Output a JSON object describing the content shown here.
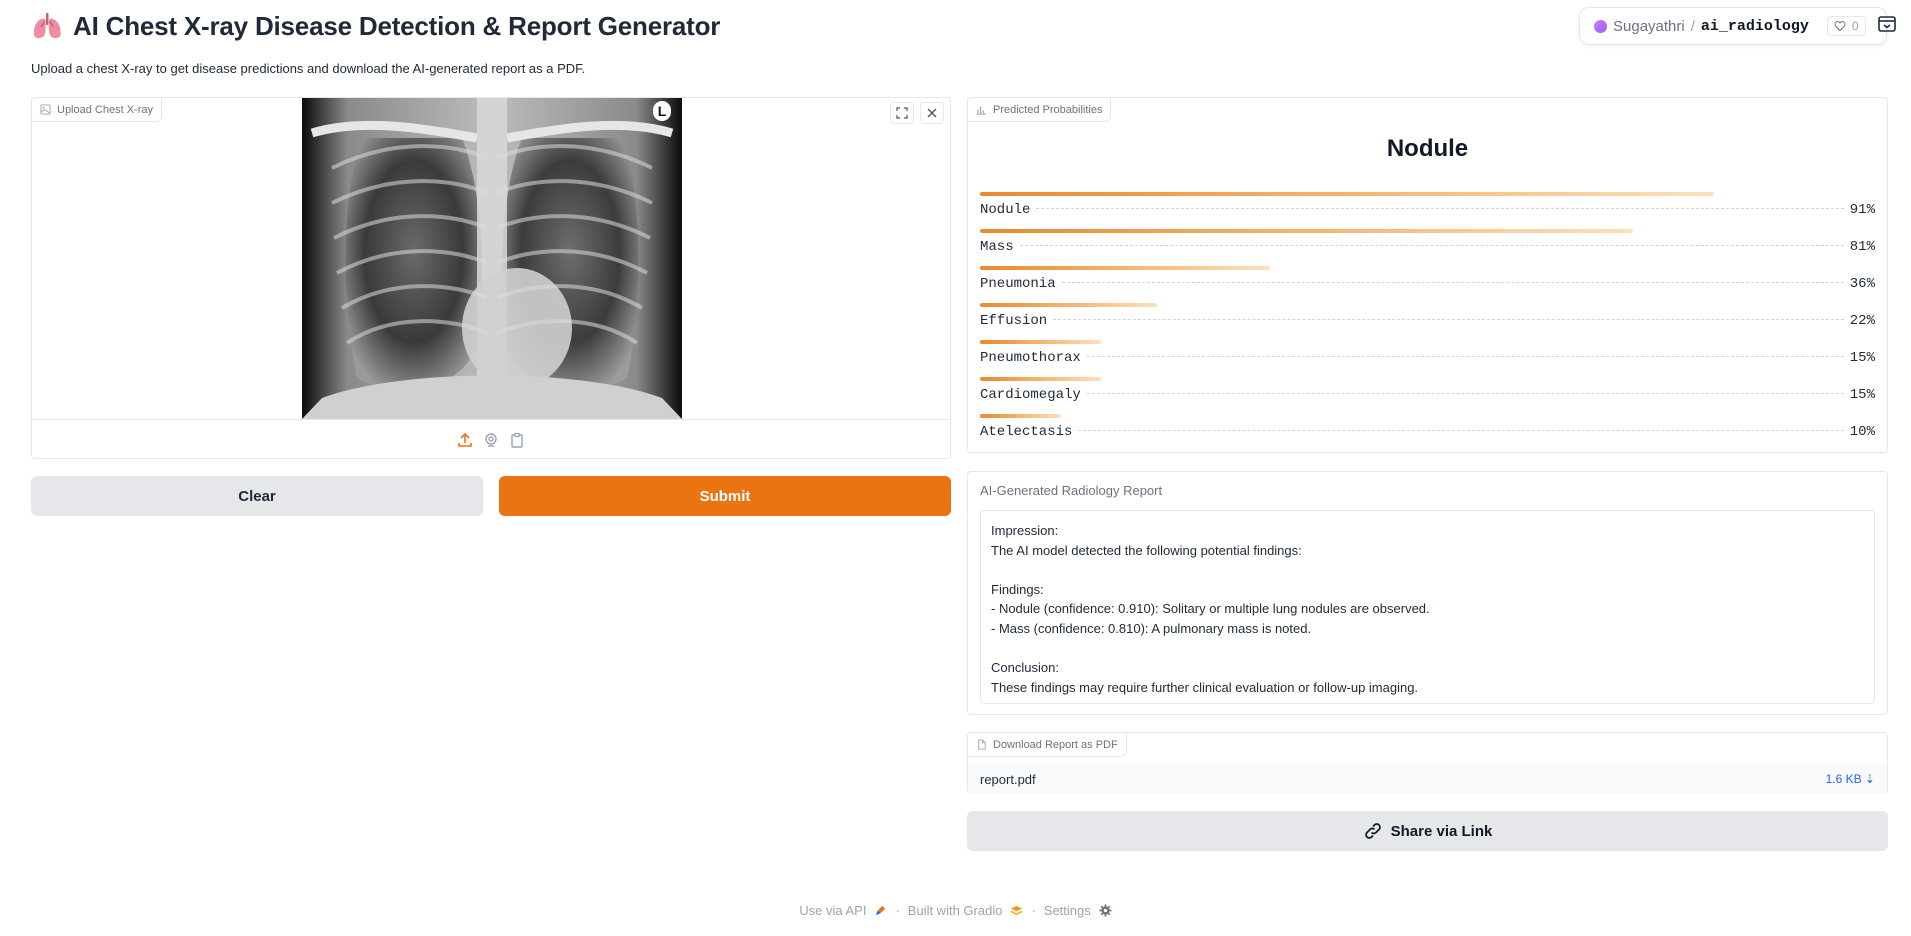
{
  "header": {
    "title": "AI Chest X-ray Disease Detection & Report Generator",
    "subtitle": "Upload a chest X-ray to get disease predictions and download the AI-generated report as a PDF."
  },
  "space": {
    "owner": "Sugayathri",
    "separator": "/",
    "name": "ai_radiology",
    "likes": "0"
  },
  "upload": {
    "label": "Upload Chest X-ray",
    "marker": "L"
  },
  "buttons": {
    "clear": "Clear",
    "submit": "Submit",
    "share": "Share via Link"
  },
  "predictions": {
    "label": "Predicted Probabilities",
    "top": "Nodule",
    "items": [
      {
        "label": "Nodule",
        "pct": "91%",
        "value": 0.91
      },
      {
        "label": "Mass",
        "pct": "81%",
        "value": 0.81
      },
      {
        "label": "Pneumonia",
        "pct": "36%",
        "value": 0.36
      },
      {
        "label": "Effusion",
        "pct": "22%",
        "value": 0.22
      },
      {
        "label": "Pneumothorax",
        "pct": "15%",
        "value": 0.15
      },
      {
        "label": "Cardiomegaly",
        "pct": "15%",
        "value": 0.15
      },
      {
        "label": "Atelectasis",
        "pct": "10%",
        "value": 0.1
      }
    ]
  },
  "report": {
    "label": "AI-Generated Radiology Report",
    "text": "Impression:\nThe AI model detected the following potential findings:\n\nFindings:\n- Nodule (confidence: 0.910): Solitary or multiple lung nodules are observed.\n- Mass (confidence: 0.810): A pulmonary mass is noted.\n\nConclusion:\nThese findings may require further clinical evaluation or follow-up imaging."
  },
  "download": {
    "label": "Download Report as PDF",
    "file_name": "report.pdf",
    "file_size": "1.6 KB ⇣"
  },
  "footer": {
    "api": "Use via API",
    "built": "Built with Gradio",
    "settings": "Settings",
    "sep": "·"
  },
  "colors": {
    "accent": "#ea7312",
    "bar_start": "#e98a2c",
    "bar_end": "#fbe0bd",
    "link": "#2563eb"
  }
}
